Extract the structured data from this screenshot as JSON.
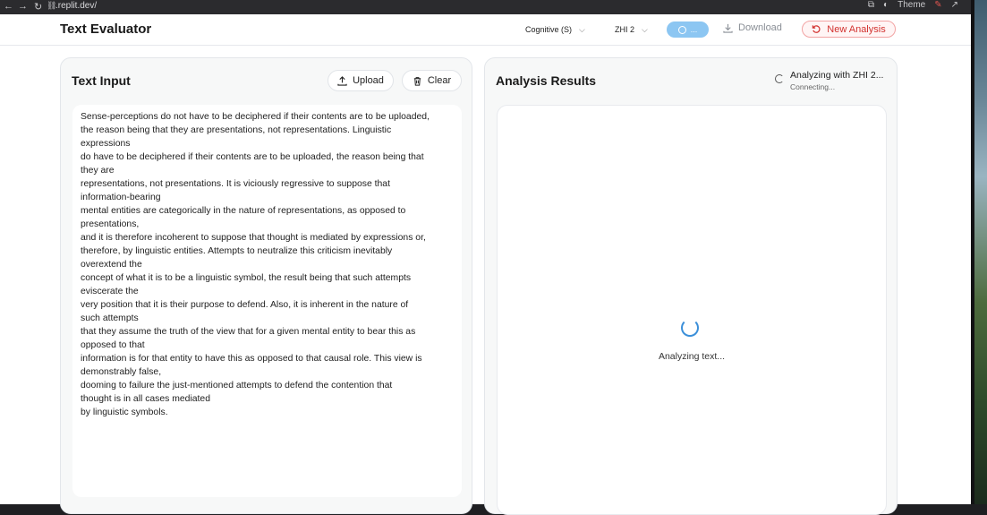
{
  "browser": {
    "url": ".replit.dev/",
    "theme_label": "Theme"
  },
  "header": {
    "app_title": "Text Evaluator",
    "mode_select": "Cognitive (S)",
    "model_select": "ZHI 2",
    "pill_label": "...",
    "download_label": "Download",
    "new_analysis_label": "New Analysis"
  },
  "input_panel": {
    "title": "Text Input",
    "upload_label": "Upload",
    "clear_label": "Clear",
    "text": "Sense-perceptions do not have to be deciphered if their contents are to be uploaded,\nthe reason being that they are presentations, not representations. Linguistic\nexpressions\ndo have to be deciphered if their contents are to be uploaded, the reason being that\nthey are\nrepresentations, not presentations. It is viciously regressive to suppose that\ninformation-bearing\nmental entities are categorically in the nature of representations, as opposed to\npresentations,\nand it is therefore incoherent to suppose that thought is mediated by expressions or,\ntherefore, by linguistic entities. Attempts to neutralize this criticism inevitably\noverextend the\nconcept of what it is to be a linguistic symbol, the result being that such attempts\neviscerate the\nvery position that it is their purpose to defend. Also, it is inherent in the nature of\nsuch attempts\nthat they assume the truth of the view that for a given mental entity to bear this as\nopposed to that\ninformation is for that entity to have this as opposed to that causal role. This view is\ndemonstrably false,\ndooming to failure the just-mentioned attempts to defend the contention that\nthought is in all cases mediated\nby linguistic symbols."
  },
  "results_panel": {
    "title": "Analysis Results",
    "status_primary": "Analyzing with ZHI 2...",
    "status_secondary": "Connecting...",
    "loading_text": "Analyzing text..."
  },
  "icons": [
    "back-icon",
    "forward-icon",
    "reload-icon",
    "link-icon",
    "terminal-icon",
    "palette-icon",
    "pin-icon",
    "external-link-icon",
    "chevron-down-icon",
    "info-icon",
    "download-icon",
    "refresh-icon",
    "upload-icon",
    "trash-icon",
    "spinner-icon"
  ],
  "colors": {
    "accent_pill": "#8cc6f2",
    "danger": "#d2312e",
    "spinner": "#3b8fd9"
  }
}
